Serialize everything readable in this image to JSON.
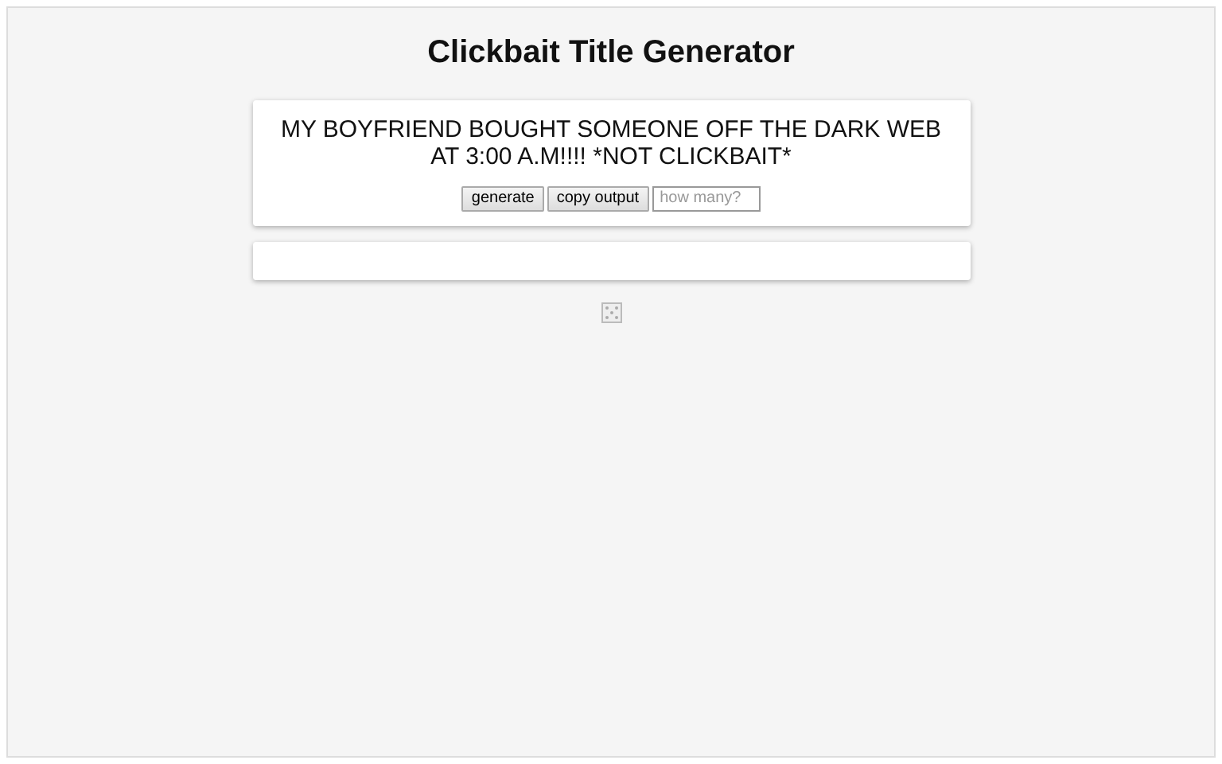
{
  "title": "Clickbait Title Generator",
  "output_title": "MY BOYFRIEND BOUGHT SOMEONE OFF THE DARK WEB AT 3:00 A.M!!!! *NOT CLICKBAIT*",
  "buttons": [
    "generate",
    "copy output"
  ],
  "count_field": {
    "placeholder": "how many?"
  }
}
